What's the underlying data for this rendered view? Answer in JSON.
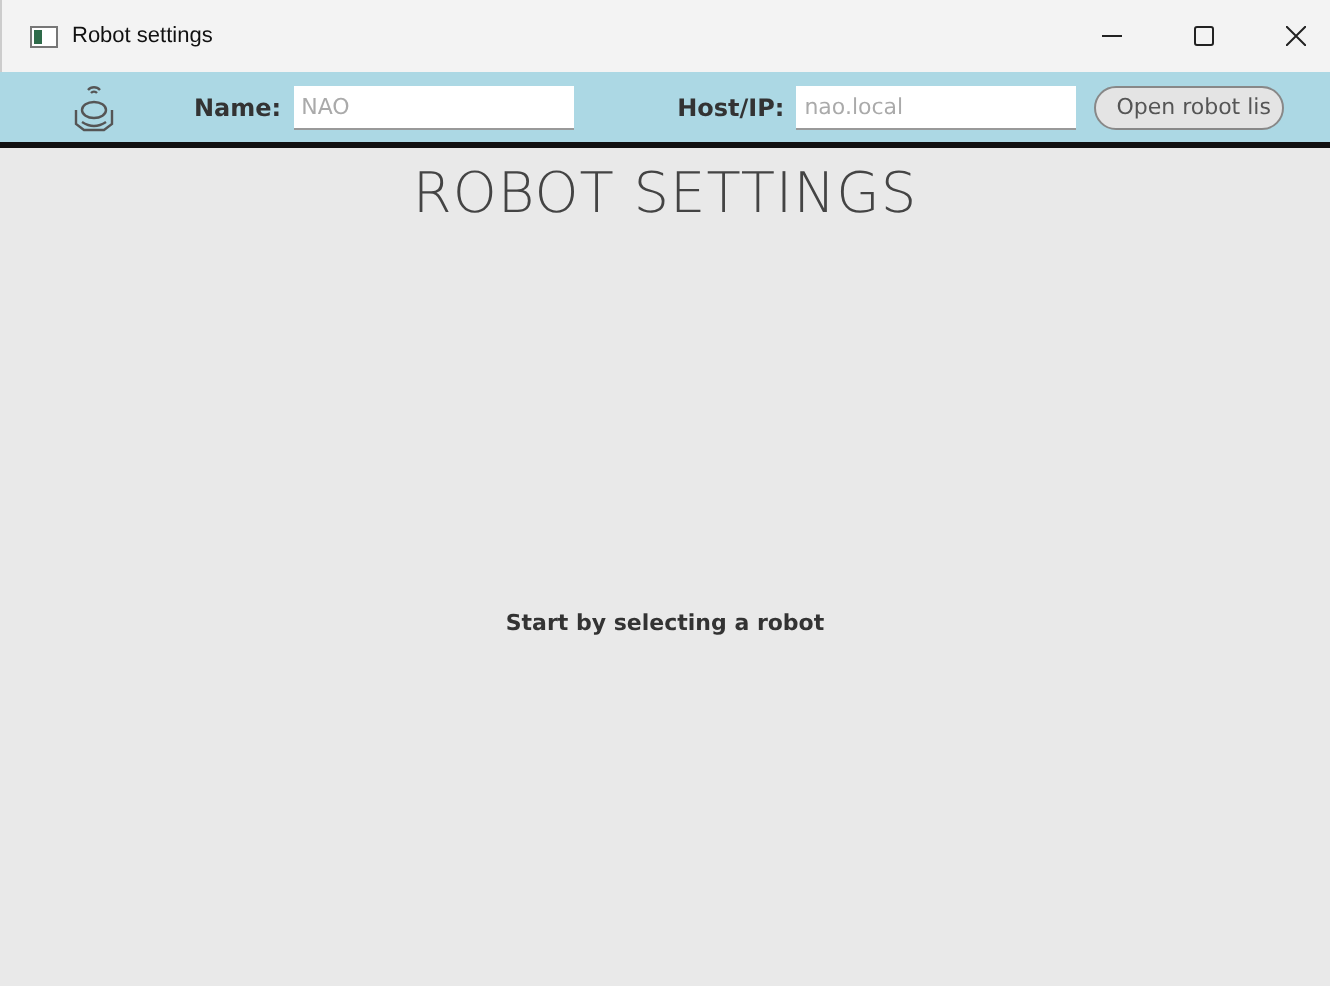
{
  "window": {
    "title": "Robot settings"
  },
  "toolbar": {
    "name_label": "Name:",
    "name_field": {
      "placeholder": "NAO"
    },
    "host_label": "Host/IP:",
    "host_field": {
      "placeholder": "nao.local"
    },
    "open_button": "Open robot lis"
  },
  "heading": "ROBOT SETTINGS",
  "message": "Start by selecting a robot"
}
